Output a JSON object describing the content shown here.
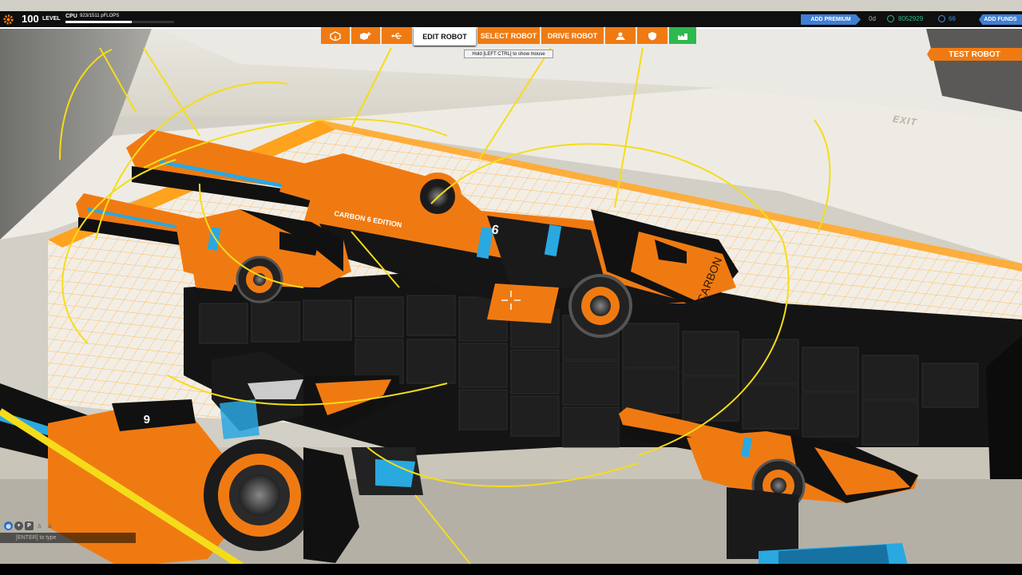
{
  "hud": {
    "level_number": "100",
    "level_label": "LEVEL",
    "cpu_label": "CPU",
    "cpu_value": "923/1511 pFLOPS",
    "cpu_fraction": 0.61
  },
  "account": {
    "add_premium": "ADD PREMIUM",
    "premium_days": "0d",
    "robits": "8052929",
    "cosmetic_credits": "66",
    "add_funds": "ADD FUNDS"
  },
  "nav": {
    "edit_robot": "EDIT ROBOT",
    "select_robot": "SELECT ROBOT",
    "drive_robot": "DRIVE ROBOT",
    "icons": [
      "cube-icon",
      "cube-plus-icon",
      "usb-icon",
      "user-profile-icon",
      "shield-icon",
      "factory-icon"
    ]
  },
  "tooltip": "Hold [LEFT CTRL] to show mouse",
  "test_robot": "TEST ROBOT",
  "chat": {
    "hint": "[ENTER] to type",
    "channel_icons": [
      "globe-icon",
      "plus-icon",
      "party-icon",
      "person-icon",
      "settings-icon"
    ]
  },
  "scene": {
    "exit_sign": "EXIT",
    "weapon_edition_label": "CARBON 6 EDITION",
    "weapon_brand": "CARBON",
    "weapon_tier": "6",
    "colors": {
      "accent_orange": "#f07a12",
      "accent_blue": "#2aa8e0",
      "grid_orange": "#ffa21e",
      "guide_yellow": "#f5dc1a",
      "block_black": "#161616"
    }
  }
}
